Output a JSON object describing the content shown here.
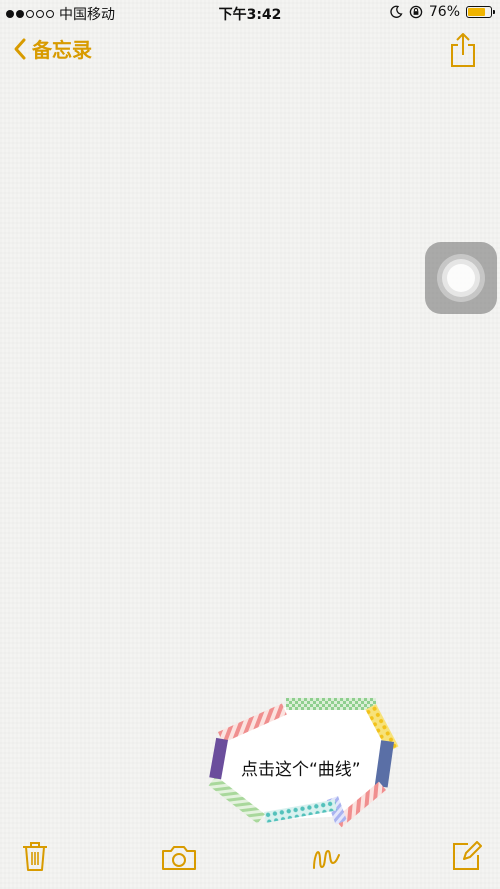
{
  "status_bar": {
    "signal_filled": 2,
    "signal_total": 5,
    "carrier": "中国移动",
    "time": "下午3:42",
    "battery_percent": "76%",
    "battery_level": 0.76
  },
  "nav": {
    "back_label": "备忘录"
  },
  "annotation": {
    "text": "点击这个“曲线”"
  },
  "colors": {
    "accent": "#d89b00",
    "battery_fill": "#f0b400"
  },
  "icons": {
    "back": "chevron-left-icon",
    "share": "share-icon",
    "assistive_touch": "assistive-touch-icon",
    "trash": "trash-icon",
    "camera": "camera-icon",
    "sketch": "sketch-curve-icon",
    "compose": "compose-icon"
  }
}
